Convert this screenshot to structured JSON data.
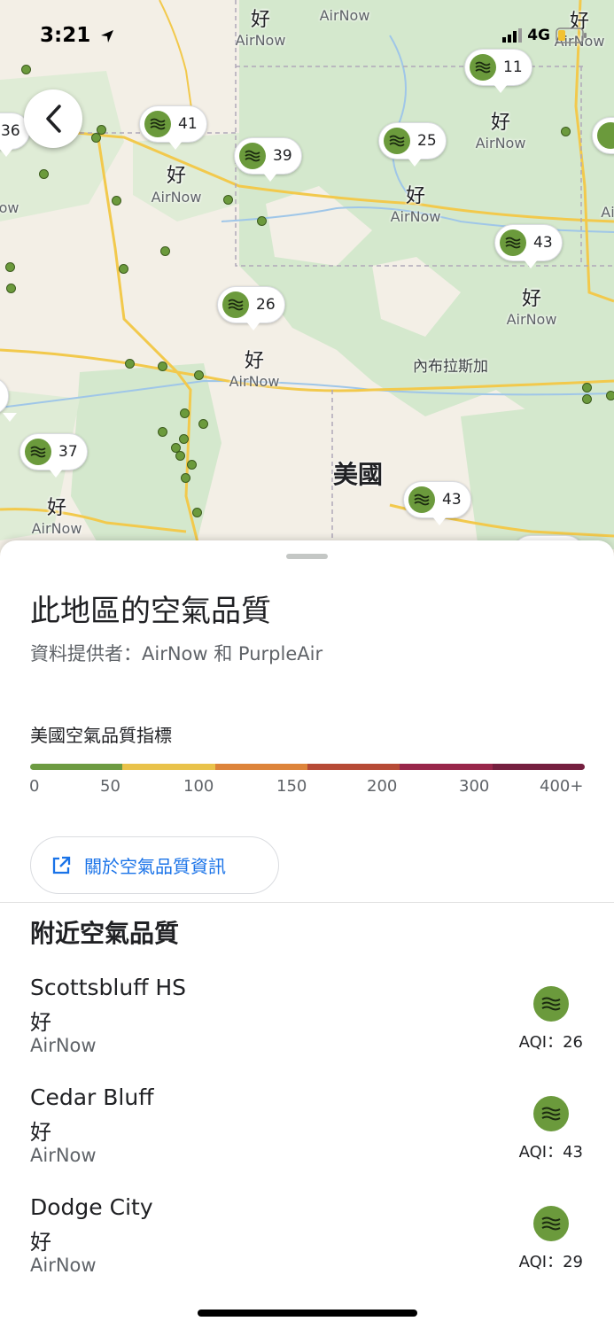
{
  "status_bar": {
    "time": "3:21",
    "network": "4G"
  },
  "map": {
    "markers": [
      {
        "value": "41",
        "quality": "好",
        "source": "AirNow"
      },
      {
        "value": "39",
        "quality": "",
        "source": ""
      },
      {
        "value": "25",
        "quality": "好",
        "source": "AirNow"
      },
      {
        "value": "11",
        "quality": "好",
        "source": "AirNow"
      },
      {
        "value": "43",
        "quality": "好",
        "source": "AirNow"
      },
      {
        "value": "26",
        "quality": "好",
        "source": "AirNow"
      },
      {
        "value": "37",
        "quality": "好",
        "source": "AirNow"
      },
      {
        "value": "43",
        "quality": "",
        "source": ""
      },
      {
        "value": "36",
        "quality": "",
        "source": ""
      }
    ],
    "top_labels": {
      "q1": "好",
      "s1": "AirNow",
      "s2": "AirNow",
      "q3": "好",
      "s3": "AirNow"
    },
    "places": {
      "nebraska": "內布拉斯加",
      "usa": "美國"
    },
    "edge_fragments": {
      "left_source": "ow",
      "right_source": "Ai"
    }
  },
  "sheet": {
    "title": "此地區的空氣品質",
    "provider": "資料提供者：AirNow 和 PurpleAir",
    "scale_label": "美國空氣品質指標",
    "scale_colors": [
      "#6d9b42",
      "#e9c24a",
      "#dd843a",
      "#b64a36",
      "#98264a",
      "#751f3f"
    ],
    "scale_ticks": [
      "0",
      "50",
      "100",
      "150",
      "200",
      "300",
      "400+"
    ],
    "info_button": "關於空氣品質資訊",
    "nearby_title": "附近空氣品質",
    "stations": [
      {
        "name": "Scottsbluff HS",
        "quality": "好",
        "source": "AirNow",
        "aqi": "AQI：26"
      },
      {
        "name": "Cedar Bluff",
        "quality": "好",
        "source": "AirNow",
        "aqi": "AQI：43"
      },
      {
        "name": "Dodge City",
        "quality": "好",
        "source": "AirNow",
        "aqi": "AQI：29"
      }
    ]
  },
  "icons": {
    "marker_icon": "air-quality-waves-icon",
    "back": "chevron-left-icon",
    "external": "open-external-icon"
  }
}
